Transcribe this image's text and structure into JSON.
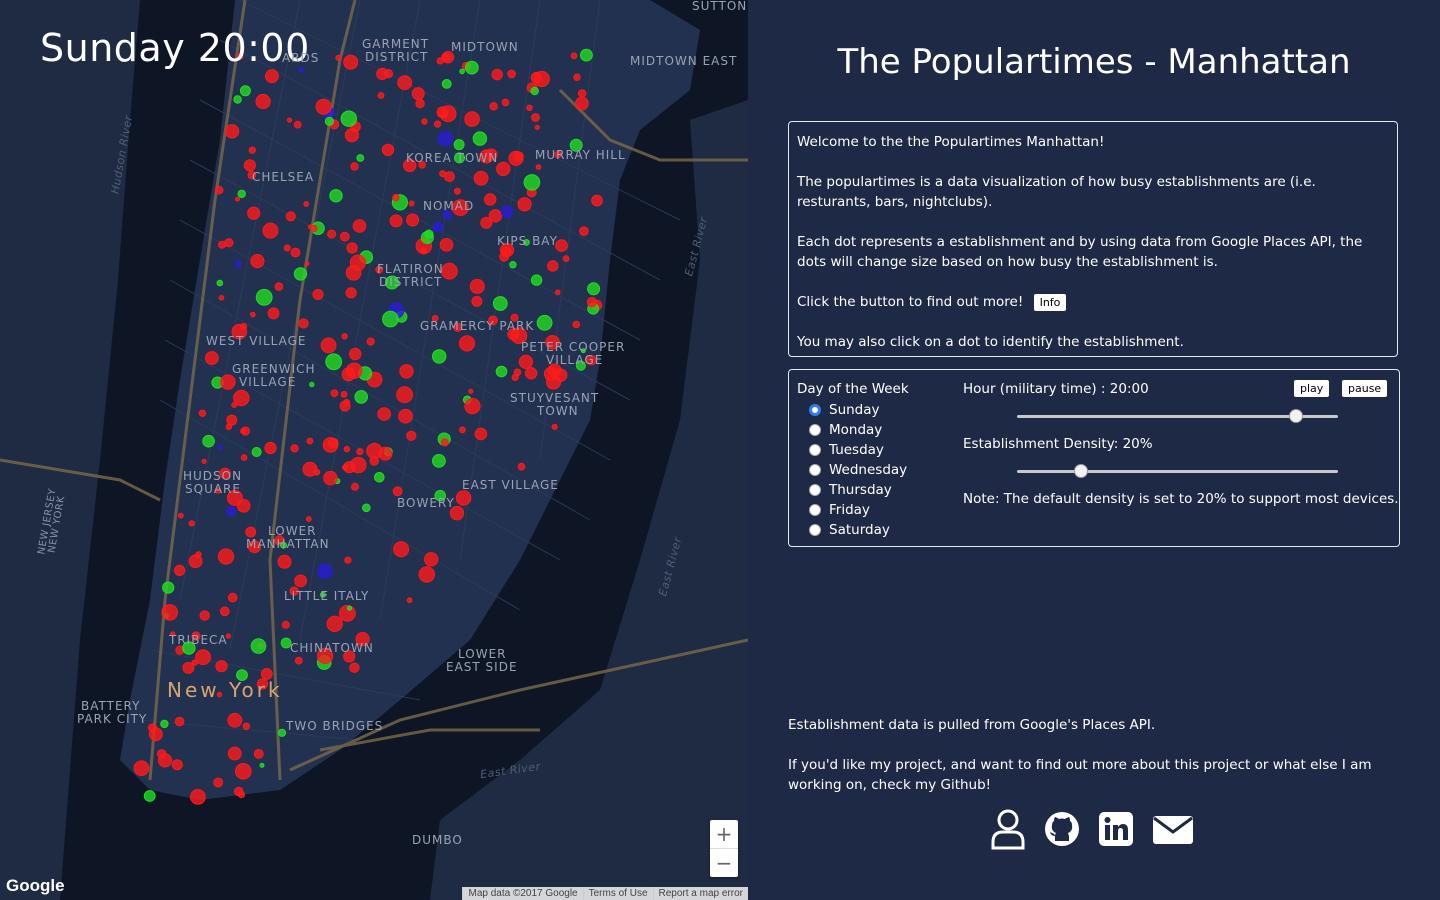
{
  "map": {
    "clock": "Sunday 20:00",
    "google": "Google",
    "footer": {
      "map_data": "Map data ©2017 Google",
      "terms": "Terms of Use",
      "report": "Report a map error"
    },
    "zoom_in": "+",
    "zoom_out": "−",
    "labels": {
      "garment": "GARMENT",
      "district": "DISTRICT",
      "midtown": "MIDTOWN",
      "midtown_east": "MIDTOWN EAST",
      "sutton": "SUTTON",
      "ards": "ARDS",
      "hudson_river": "Hudson River",
      "korea_town": "KOREA TOWN",
      "murray_hill": "MURRAY HILL",
      "chelsea": "CHELSEA",
      "nomad": "NOMAD",
      "kips_bay": "KIPS BAY",
      "flatiron": "FLATIRON",
      "flatiron_district": "DISTRICT",
      "gramercy_park": "GRAMERCY PARK",
      "peter_cooper": "PETER COOPER",
      "village": "VILLAGE",
      "west_village": "WEST VILLAGE",
      "greenwich": "GREENWICH",
      "greenwich_village": "VILLAGE",
      "stuyvesant": "STUYVESANT",
      "town": "TOWN",
      "hudson_square_1": "HUDSON",
      "hudson_square_2": "SQUARE",
      "east_village": "EAST VILLAGE",
      "bowery": "BOWERY",
      "lower": "LOWER",
      "manhattan": "MANHATTAN",
      "new_jersey": "NEW JERSEY",
      "new_york_state": "NEW YORK",
      "little_italy": "LITTLE ITALY",
      "tribeca": "TRIBECA",
      "chinatown": "CHINATOWN",
      "lower_east": "LOWER",
      "east_side": "EAST SIDE",
      "new_york_city": "New York",
      "battery": "BATTERY",
      "park_city": "PARK CITY",
      "two_bridges": "TWO BRIDGES",
      "east_river": "East River",
      "east_river_2": "East River",
      "east_river_3": "East River",
      "dumbo": "DUMBO"
    }
  },
  "panel": {
    "title": "The Populartimes - Manhattan",
    "intro": {
      "welcome": "Welcome to the the Populartimes Manhattan!",
      "description": "The populartimes is a data visualization of how busy establishments are (i.e. resturants, bars, nightclubs).",
      "dots": "Each dot represents a establishment and by using data from Google Places API, the dots will change size based on how busy the establishment is.",
      "click_text": "Click the button to find out more!",
      "info_button": "Info",
      "identify": "You may also click on a dot to identify the establishment."
    },
    "controls": {
      "day_heading": "Day of the Week",
      "days": [
        "Sunday",
        "Monday",
        "Tuesday",
        "Wednesday",
        "Thursday",
        "Friday",
        "Saturday"
      ],
      "selected_day": "Sunday",
      "hour_label": "Hour (military time) : 20:00",
      "hour_value": 20,
      "hour_max": 23,
      "play": "play",
      "pause": "pause",
      "density_label": "Establishment Density: 20%",
      "density_value": 0.2,
      "note": "Note: The default density is set to 20% to support most devices."
    },
    "footer": {
      "source": "Establishment data is pulled from Google's Places API.",
      "github": "If you'd like my project, and want to find out more about this project or what else I am working on, check my Github!"
    },
    "icons": [
      "user-icon",
      "github-icon",
      "linkedin-icon",
      "mail-icon"
    ]
  },
  "colors": {
    "background": "#1e2a45",
    "busy_dot": "#ff1a1a",
    "quiet_dot": "#22dd22",
    "other_dot": "#2b1bd6",
    "radio_accent": "#2f7df6"
  }
}
